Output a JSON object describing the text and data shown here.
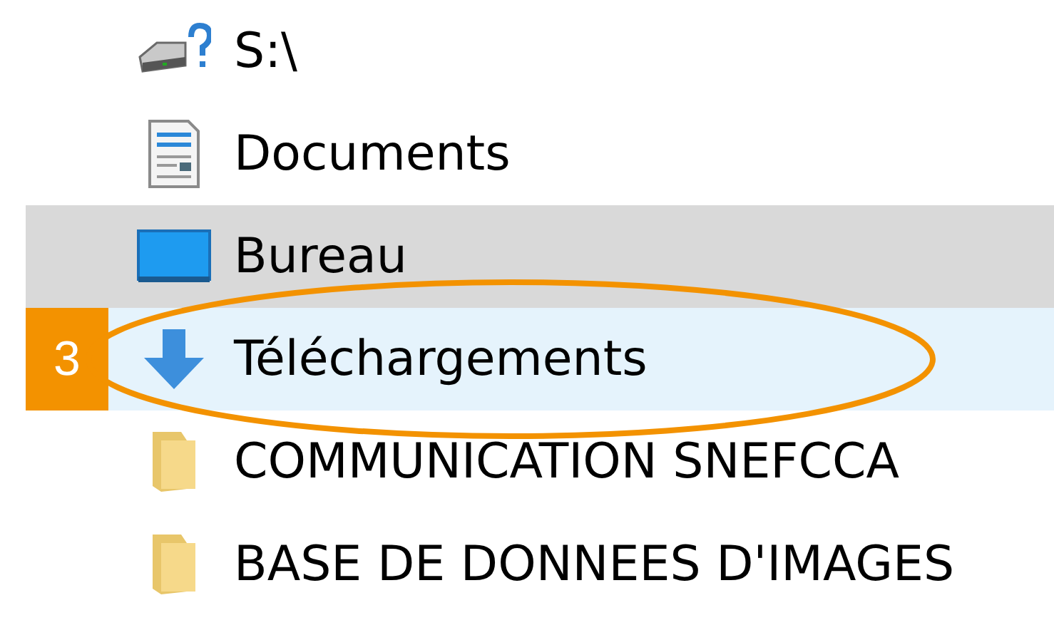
{
  "nav_pane": {
    "items": [
      {
        "kind": "drive",
        "label": "S:\\",
        "hovered": false,
        "selected": false
      },
      {
        "kind": "document",
        "label": "Documents",
        "hovered": false,
        "selected": false
      },
      {
        "kind": "desktop",
        "label": "Bureau",
        "hovered": true,
        "selected": false
      },
      {
        "kind": "download",
        "label": "Téléchargements",
        "hovered": false,
        "selected": true,
        "callout": "3"
      },
      {
        "kind": "folder",
        "label": "COMMUNICATION SNEFCCA",
        "hovered": false,
        "selected": false
      },
      {
        "kind": "folder",
        "label": "BASE DE DONNEES D'IMAGES",
        "hovered": false,
        "selected": false
      }
    ]
  }
}
